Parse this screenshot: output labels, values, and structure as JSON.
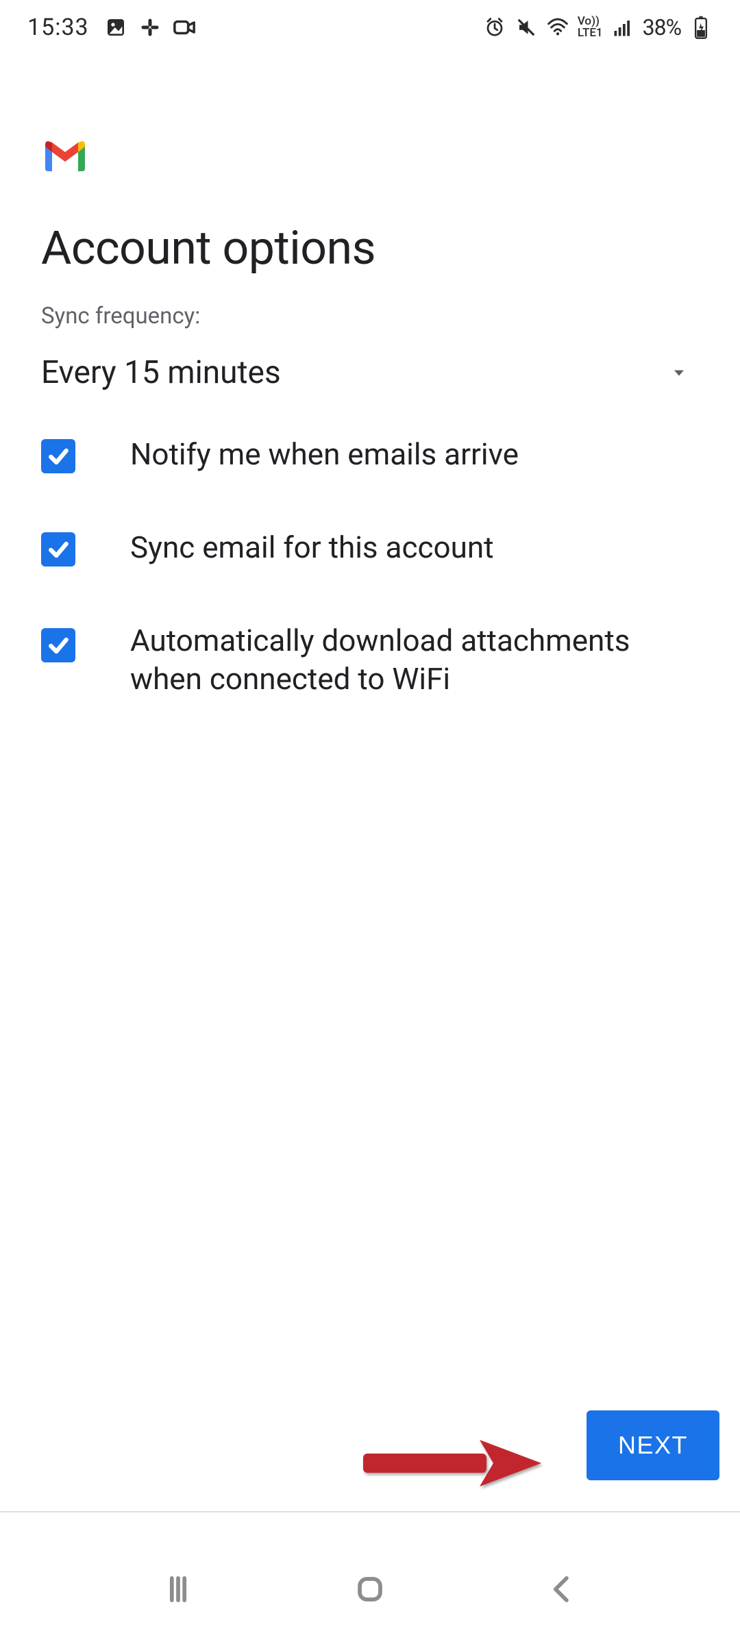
{
  "status_bar": {
    "time": "15:33",
    "battery_text": "38%",
    "lte_top": "Vo))",
    "lte_bottom": "LTE1"
  },
  "page": {
    "title": "Account options",
    "sync_label": "Sync frequency:",
    "sync_value": "Every 15 minutes"
  },
  "options": {
    "notify": "Notify me when emails arrive",
    "sync": "Sync email for this account",
    "attachments": "Automatically download attachments when connected to WiFi"
  },
  "footer": {
    "next": "NEXT"
  },
  "colors": {
    "primary": "#1a73e8",
    "text": "#202124",
    "muted": "#5f6368",
    "arrow": "#c1272d"
  }
}
